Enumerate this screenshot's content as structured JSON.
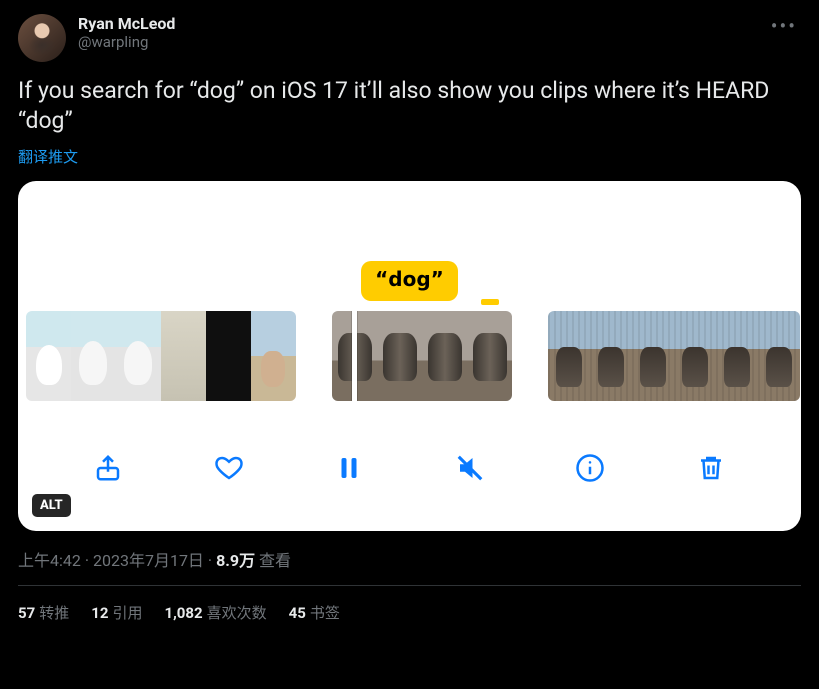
{
  "author": {
    "display_name": "Ryan McLeod",
    "handle": "@warpling"
  },
  "body": "If you search for “dog” on iOS 17 it’ll also show you clips where it’s HEARD “dog”",
  "translate_label": "翻译推文",
  "media": {
    "bubble_text": "“dog”",
    "alt_badge": "ALT"
  },
  "meta": {
    "time": "上午4:42",
    "date": "2023年7月17日",
    "views_number": "8.9万",
    "views_label": "查看",
    "separator": " · "
  },
  "stats": {
    "retweets": {
      "count": "57",
      "label": "转推"
    },
    "quotes": {
      "count": "12",
      "label": "引用"
    },
    "likes": {
      "count": "1,082",
      "label": "喜欢次数"
    },
    "bookmarks": {
      "count": "45",
      "label": "书签"
    }
  }
}
